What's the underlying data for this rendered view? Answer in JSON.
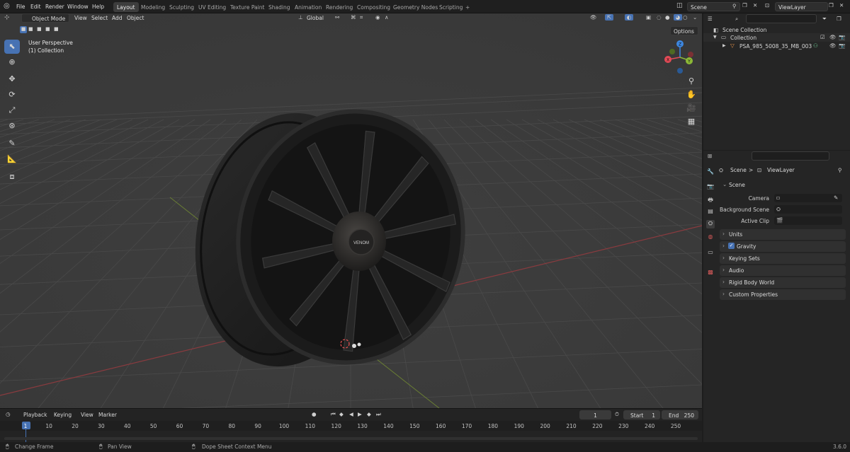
{
  "topbar": {
    "menus": [
      "File",
      "Edit",
      "Render",
      "Window",
      "Help"
    ],
    "workspaces": [
      "Layout",
      "Modeling",
      "Sculpting",
      "UV Editing",
      "Texture Paint",
      "Shading",
      "Animation",
      "Rendering",
      "Compositing",
      "Geometry Nodes",
      "Scripting"
    ],
    "active_workspace": "Layout",
    "add_tab": "+",
    "scene_name": "Scene",
    "view_layer_name": "ViewLayer"
  },
  "viewport": {
    "mode": "Object Mode",
    "menus": [
      "View",
      "Select",
      "Add",
      "Object"
    ],
    "transform_orientation": "Global",
    "overlay_title": "User Perspective",
    "overlay_subtitle": "(1) Collection",
    "options_label": "Options",
    "gizmo": {
      "x": "X",
      "y": "Y",
      "z": "Z"
    },
    "wheel_logo": "VENOM"
  },
  "outliner": {
    "root": "Scene Collection",
    "collection": "Collection",
    "object": "PSA_985_5008_35_MB_003"
  },
  "properties": {
    "breadcrumb_scene": "Scene",
    "breadcrumb_sep": ">",
    "breadcrumb_layer": "ViewLayer",
    "scene_panel": "Scene",
    "camera_label": "Camera",
    "background_label": "Background Scene",
    "clip_label": "Active Clip",
    "panels": [
      "Units",
      "Gravity",
      "Keying Sets",
      "Audio",
      "Rigid Body World",
      "Custom Properties"
    ],
    "gravity_checked": true
  },
  "timeline": {
    "menus": [
      "Playback",
      "Keying",
      "View",
      "Marker"
    ],
    "current_frame": "1",
    "start_label": "Start",
    "start_value": "1",
    "end_label": "End",
    "end_value": "250",
    "ticks": [
      "1",
      "10",
      "20",
      "30",
      "40",
      "50",
      "60",
      "70",
      "80",
      "90",
      "100",
      "110",
      "120",
      "130",
      "140",
      "150",
      "160",
      "170",
      "180",
      "190",
      "200",
      "210",
      "220",
      "230",
      "240",
      "250"
    ]
  },
  "statusbar": {
    "left": "Change Frame",
    "middle": "Pan View",
    "right": "Dope Sheet Context Menu",
    "version": "3.6.0"
  },
  "colors": {
    "accent": "#4772b3",
    "axis_x": "#e34a56",
    "axis_y": "#8bb836",
    "axis_z": "#3d87e0",
    "grid": "#4a4a4a",
    "viewport_bg": "#3c3c3c"
  }
}
